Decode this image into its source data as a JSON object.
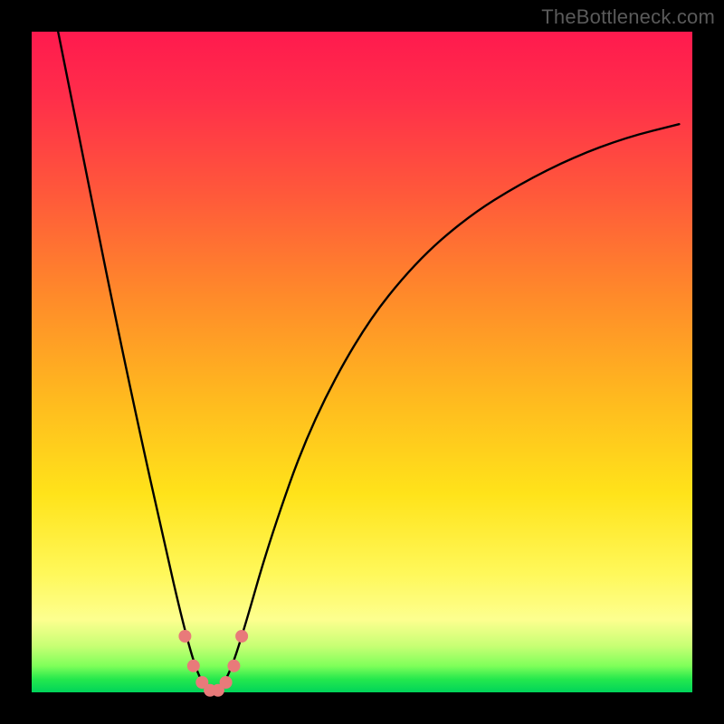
{
  "watermark": "TheBottleneck.com",
  "chart_data": {
    "type": "line",
    "title": "",
    "xlabel": "",
    "ylabel": "",
    "xlim": [
      0,
      100
    ],
    "ylim": [
      0,
      100
    ],
    "grid": false,
    "legend": false,
    "series": [
      {
        "name": "bottleneck-curve",
        "color": "#000000",
        "x": [
          4,
          8,
          12,
          16,
          20,
          23,
          25,
          26.5,
          27.5,
          28.5,
          30,
          32,
          36,
          42,
          50,
          58,
          66,
          74,
          82,
          90,
          98
        ],
        "y": [
          100,
          80,
          60,
          41,
          23,
          10,
          3,
          0.5,
          0,
          0.5,
          3,
          9,
          23,
          40,
          55,
          65,
          72,
          77,
          81,
          84,
          86
        ]
      },
      {
        "name": "valley-markers",
        "type": "scatter",
        "color": "#e87a7a",
        "x": [
          23.2,
          24.5,
          25.8,
          27.0,
          28.2,
          29.4,
          30.6,
          31.8
        ],
        "y": [
          8.5,
          4.0,
          1.5,
          0.3,
          0.3,
          1.5,
          4.0,
          8.5
        ]
      }
    ],
    "background_gradient": {
      "top": "#ff1a4e",
      "mid1": "#ff8a2a",
      "mid2": "#ffe31a",
      "lower": "#fdff8f",
      "bottom": "#00d45a"
    }
  }
}
